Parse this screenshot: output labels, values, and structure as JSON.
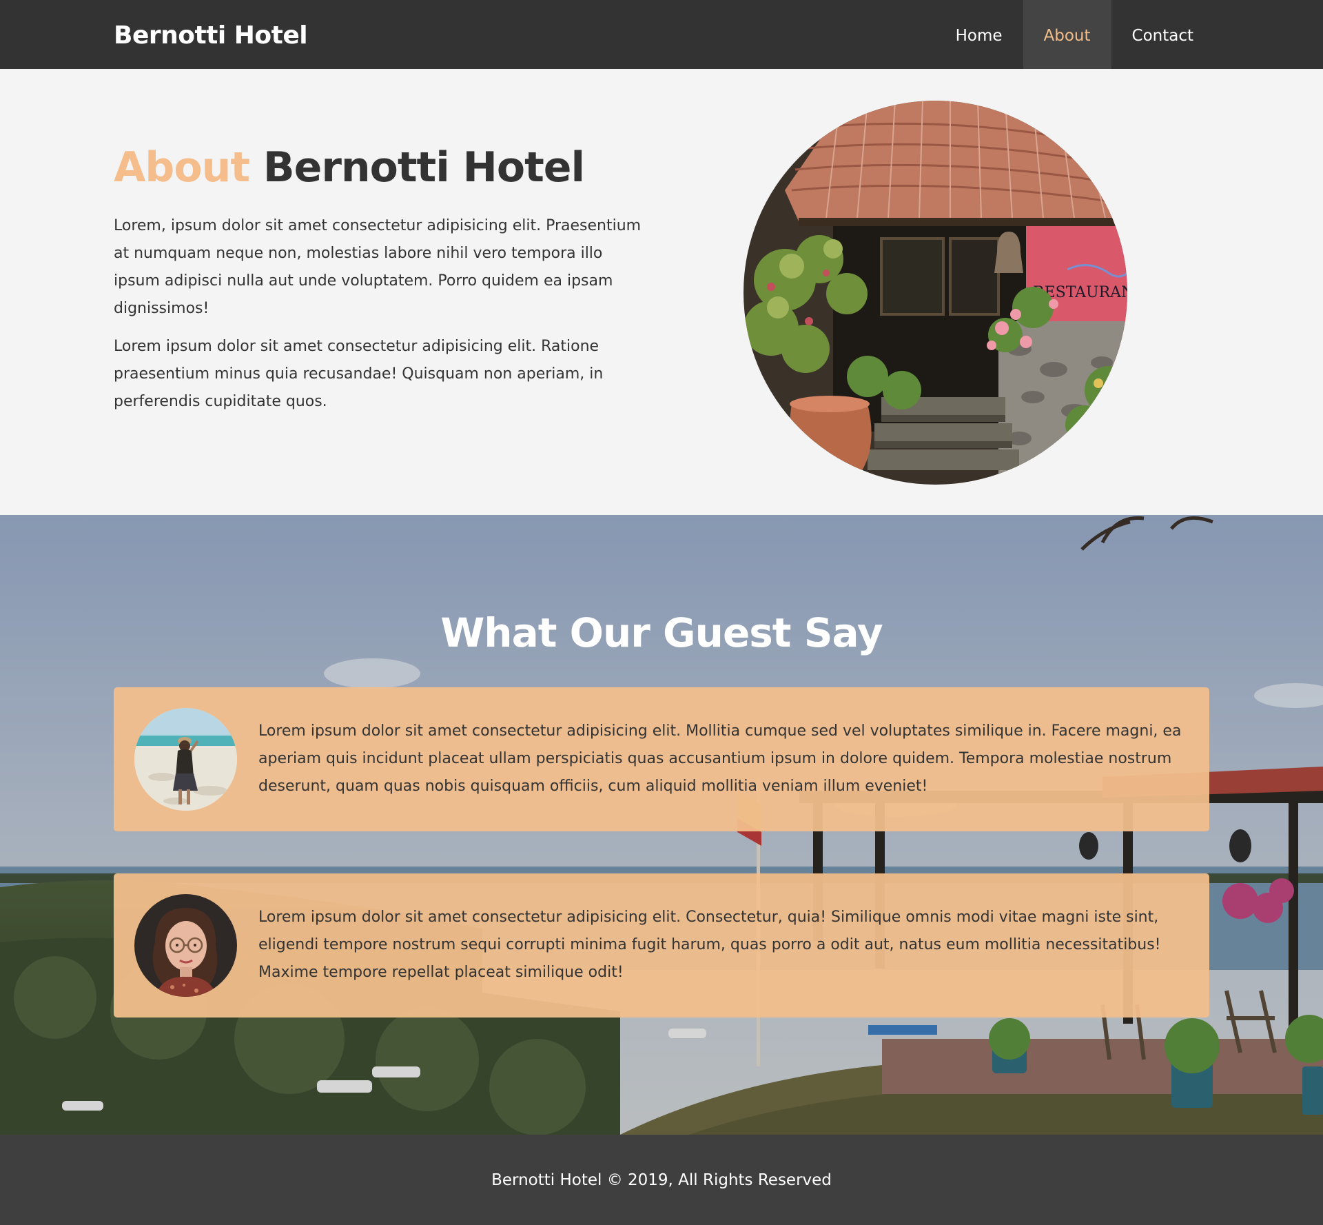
{
  "navbar": {
    "brand": "Bernotti Hotel",
    "links": [
      {
        "label": "Home",
        "active": false
      },
      {
        "label": "About",
        "active": true
      },
      {
        "label": "Contact",
        "active": false
      }
    ]
  },
  "about": {
    "title_accent": "About",
    "title_rest": "Bernotti Hotel",
    "paragraphs": [
      "Lorem, ipsum dolor sit amet consectetur adipisicing elit. Praesentium at numquam neque non, molestias labore nihil vero tempora illo ipsum adipisci nulla aut unde voluptatem. Porro quidem ea ipsam dignissimos!",
      "Lorem ipsum dolor sit amet consectetur adipisicing elit. Ratione praesentium minus quia recusandae! Quisquam non aperiam, in perferendis cupiditate quos."
    ],
    "image_sign_text": "RESTAURANT"
  },
  "testimonials": {
    "heading": "What Our Guest Say",
    "items": [
      {
        "text": "Lorem ipsum dolor sit amet consectetur adipisicing elit. Mollitia cumque sed vel voluptates similique in. Facere magni, ea aperiam quis incidunt placeat ullam perspiciatis quas accusantium ipsum in dolore quidem. Tempora molestiae nostrum deserunt, quam quas nobis quisquam officiis, cum aliquid mollitia veniam illum eveniet!"
      },
      {
        "text": "Lorem ipsum dolor sit amet consectetur adipisicing elit. Consectetur, quia! Similique omnis modi vitae magni iste sint, eligendi tempore nostrum sequi corrupti minima fugit harum, quas porro a odit aut, natus eum mollitia necessitatibus! Maxime tempore repellat placeat similique odit!"
      }
    ]
  },
  "footer": {
    "text": "Bernotti Hotel © 2019, All Rights Reserved"
  },
  "colors": {
    "navbar_bg": "#333333",
    "accent": "#f4bd8b",
    "card_bg": "#f2be8c",
    "footer_bg": "#3f3f3f",
    "page_bg": "#f4f4f4"
  }
}
